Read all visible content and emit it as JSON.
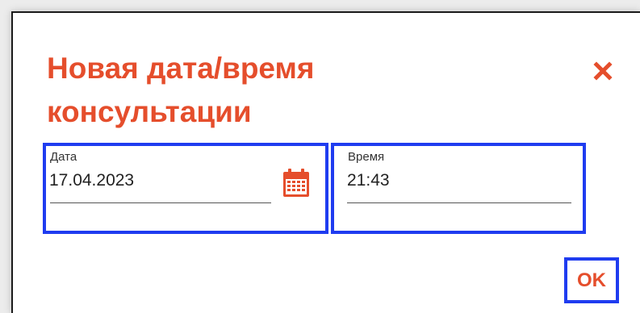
{
  "dialog": {
    "title": "Новая дата/время консультации",
    "close_icon": "close-icon",
    "accent_color": "#e54e2c",
    "focus_color": "#1f3cf0"
  },
  "date_field": {
    "label": "Дата",
    "value": "17.04.2023",
    "icon": "calendar-icon"
  },
  "time_field": {
    "label": "Время",
    "value": "21:43"
  },
  "actions": {
    "ok_label": "OK"
  }
}
